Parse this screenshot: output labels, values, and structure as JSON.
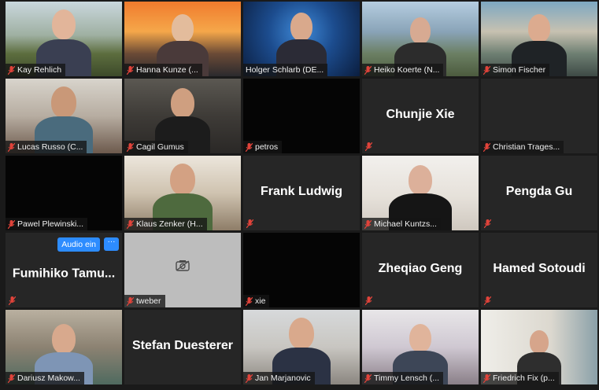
{
  "app": "Zoom Gallery View",
  "tiles": [
    {
      "name": "Kay Rehlich",
      "video": true
    },
    {
      "name": "Hanna Kunze (...",
      "video": true
    },
    {
      "name": "Holger Schlarb (DE...",
      "video": true,
      "active": true
    },
    {
      "name": "Heiko Koerte (N...",
      "video": true
    },
    {
      "name": "Simon Fischer",
      "video": true
    },
    {
      "name": "Lucas Russo (C...",
      "video": true
    },
    {
      "name": "Cagil Gumus",
      "video": true
    },
    {
      "name": "petros",
      "video": false
    },
    {
      "name": "",
      "display_name": "Chunjie Xie",
      "video": false
    },
    {
      "name": "Christian Trages...",
      "video": false
    },
    {
      "name": "Pawel Plewinski...",
      "video": false
    },
    {
      "name": "Klaus Zenker (H...",
      "video": true
    },
    {
      "name": "",
      "display_name": "Frank Ludwig",
      "video": false
    },
    {
      "name": "Michael Kuntzs...",
      "video": true
    },
    {
      "name": "",
      "display_name": "Pengda Gu",
      "video": false
    },
    {
      "name": "",
      "display_name": "Fumihiko  Tamu...",
      "video": false,
      "hover": true
    },
    {
      "name": "tweber",
      "video": false,
      "camera_off": true
    },
    {
      "name": "xie",
      "video": false
    },
    {
      "name": "",
      "display_name": "Zheqiao Geng",
      "video": false
    },
    {
      "name": "",
      "display_name": "Hamed Sotoudi",
      "video": false
    },
    {
      "name": "Dariusz Makow...",
      "video": true
    },
    {
      "name": "",
      "display_name": "Stefan Duesterer",
      "video": false
    },
    {
      "name": "Jan Marjanovic",
      "video": true
    },
    {
      "name": "Timmy Lensch (...",
      "video": true
    },
    {
      "name": "Friedrich Fix (p...",
      "video": true
    }
  ],
  "hover_controls": {
    "audio_label": "Audio ein",
    "more_label": "···"
  },
  "colors": {
    "active_border": "#f4e04d",
    "mic_muted": "#e0433a",
    "button_blue": "#2d8cff"
  }
}
